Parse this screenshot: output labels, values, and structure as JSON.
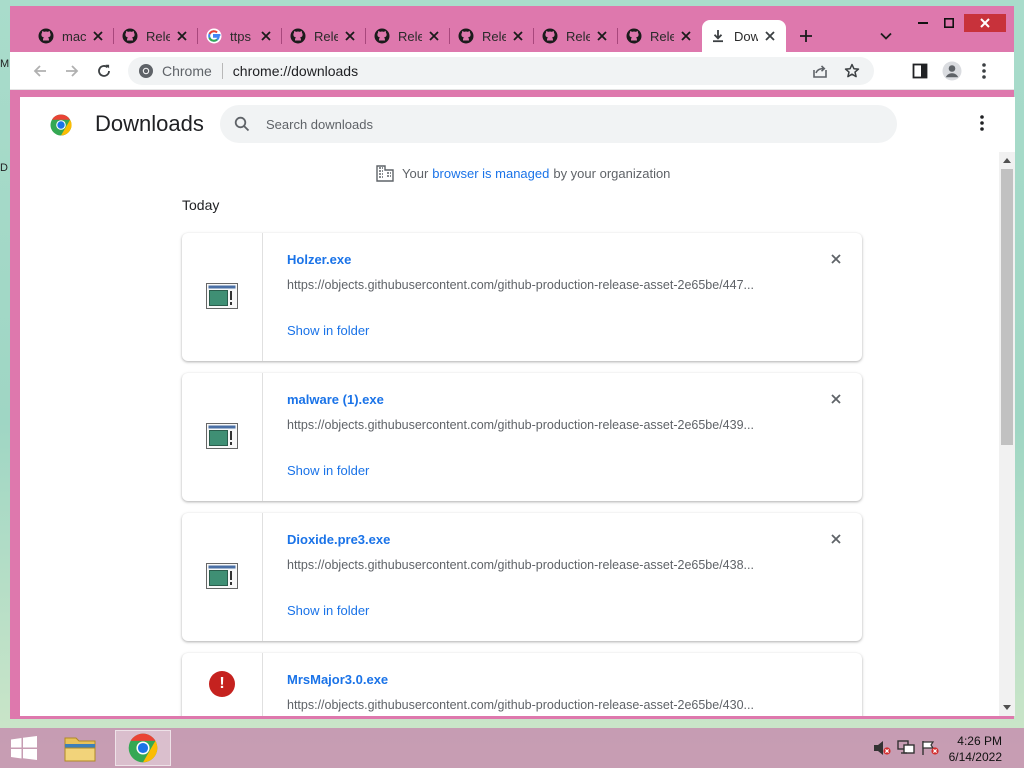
{
  "desktop_edge_labels": [
    "M",
    "D"
  ],
  "browser": {
    "tabs": [
      {
        "label": "mac",
        "icon": "github-icon"
      },
      {
        "label": "Rele",
        "icon": "github-icon"
      },
      {
        "label": "ttps",
        "icon": "google-icon"
      },
      {
        "label": "Rele",
        "icon": "github-icon"
      },
      {
        "label": "Rele",
        "icon": "github-icon"
      },
      {
        "label": "Rele",
        "icon": "github-icon"
      },
      {
        "label": "Rele",
        "icon": "github-icon"
      },
      {
        "label": "Rele",
        "icon": "github-icon"
      },
      {
        "label": "Dow",
        "icon": "download-icon",
        "active": true
      }
    ],
    "omnibox": {
      "site_label": "Chrome",
      "url": "chrome://downloads"
    }
  },
  "downloads": {
    "title": "Downloads",
    "search_placeholder": "Search downloads",
    "managed_notice": {
      "prefix": "Your",
      "link": "browser is managed",
      "suffix": "by your organization"
    },
    "section": "Today",
    "items": [
      {
        "name": "Holzer.exe",
        "url": "https://objects.githubusercontent.com/github-production-release-asset-2e65be/447...",
        "action": "Show in folder"
      },
      {
        "name": "malware (1).exe",
        "url": "https://objects.githubusercontent.com/github-production-release-asset-2e65be/439...",
        "action": "Show in folder"
      },
      {
        "name": "Dioxide.pre3.exe",
        "url": "https://objects.githubusercontent.com/github-production-release-asset-2e65be/438...",
        "action": "Show in folder"
      },
      {
        "name": "MrsMajor3.0.exe",
        "url": "https://objects.githubusercontent.com/github-production-release-asset-2e65be/430...",
        "status_icon": "warning-icon"
      }
    ]
  },
  "taskbar": {
    "time": "4:26 PM",
    "date": "6/14/2022",
    "apps": [
      "file-explorer",
      "chrome"
    ]
  },
  "colors": {
    "window_frame": "#de78ad",
    "accent_link": "#1a73e8",
    "warning": "#c5221f"
  }
}
